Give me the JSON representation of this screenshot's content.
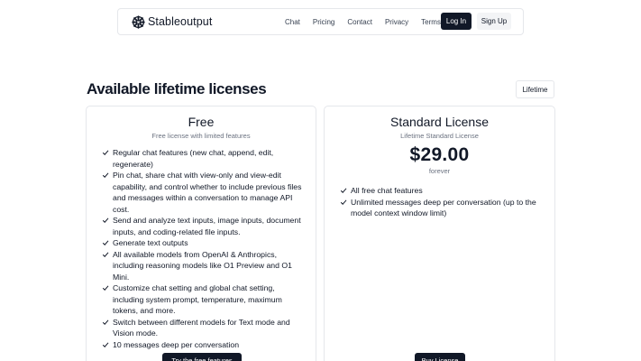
{
  "brand": {
    "name": "Stableoutput",
    "icon": "stableoutput-logo-icon"
  },
  "nav": {
    "links": [
      "Chat",
      "Pricing",
      "Contact",
      "Privacy",
      "Terms"
    ],
    "login_label": "Log In",
    "signup_label": "Sign Up"
  },
  "section": {
    "title": "Available lifetime licenses",
    "toggle_label": "Lifetime"
  },
  "plans": [
    {
      "title": "Free",
      "subtitle": "Free license with limited features",
      "features": [
        "Regular chat features (new chat, append, edit, regenerate)",
        "Pin chat, share chat with view-only and view-edit capability, and control whether to include previous files and messages within a conversation to manage API cost.",
        "Send and analyze text inputs, image inputs, document inputs, and coding-related file inputs.",
        "Generate text outputs",
        "All available models from OpenAI & Anthropics, including reasoning models like O1 Preview and O1 Mini.",
        "Customize chat setting and global chat setting, including system prompt, temperature, maximum tokens, and more.",
        "Switch between different models for Text mode and Vision mode.",
        "10 messages deep per conversation"
      ],
      "cta_label": "Try the free features"
    },
    {
      "title": "Standard License",
      "subtitle": "Lifetime Standard License",
      "price": "$29.00",
      "period": "forever",
      "features": [
        "All free chat features",
        "Unlimited messages deep per conversation (up to the model context window limit)"
      ],
      "cta_label": "Buy License"
    }
  ],
  "colors": {
    "primary": "#111827",
    "muted": "#6b7280",
    "border": "#e5e7eb"
  }
}
